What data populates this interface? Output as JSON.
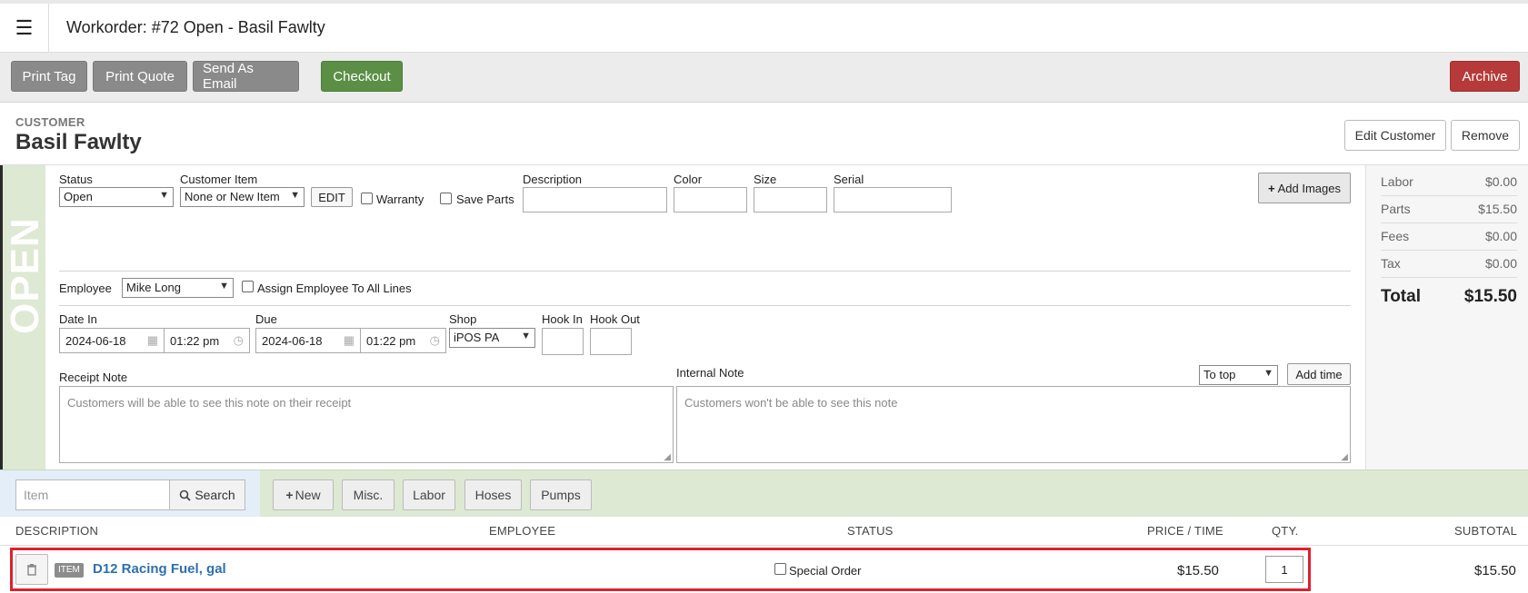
{
  "header": {
    "title": "Workorder:  #72 Open - Basil Fawlty"
  },
  "actions": {
    "print_tag": "Print Tag",
    "print_quote": "Print Quote",
    "send_email": "Send As Email",
    "checkout": "Checkout",
    "archive": "Archive"
  },
  "customer": {
    "label": "CUSTOMER",
    "name": "Basil Fawlty",
    "edit_label": "Edit Customer",
    "remove_label": "Remove"
  },
  "status_strip": "OPEN",
  "form": {
    "status_label": "Status",
    "status_value": "Open",
    "customer_item_label": "Customer Item",
    "customer_item_value": "None or New Item",
    "edit_btn": "EDIT",
    "warranty_label": "Warranty",
    "save_parts_label": "Save Parts",
    "description_label": "Description",
    "color_label": "Color",
    "size_label": "Size",
    "serial_label": "Serial",
    "add_images": "Add Images",
    "employee_label": "Employee",
    "employee_value": "Mike Long",
    "assign_all_label": "Assign Employee To All Lines",
    "date_in_label": "Date In",
    "date_in": "2024-06-18",
    "time_in": "01:22 pm",
    "due_label": "Due",
    "due_date": "2024-06-18",
    "due_time": "01:22 pm",
    "shop_label": "Shop",
    "shop_value": "iPOS PA",
    "hook_in_label": "Hook In",
    "hook_out_label": "Hook Out",
    "receipt_note_label": "Receipt Note",
    "receipt_note_placeholder": "Customers will be able to see this note on their receipt",
    "internal_note_label": "Internal Note",
    "internal_note_placeholder": "Customers won't be able to see this note",
    "to_top_value": "To top",
    "add_time": "Add time"
  },
  "summary": {
    "labor_label": "Labor",
    "labor": "$0.00",
    "parts_label": "Parts",
    "parts": "$15.50",
    "fees_label": "Fees",
    "fees": "$0.00",
    "tax_label": "Tax",
    "tax": "$0.00",
    "total_label": "Total",
    "total": "$15.50"
  },
  "item_bar": {
    "item_placeholder": "Item",
    "search_label": "Search",
    "new_label": "New",
    "misc_label": "Misc.",
    "labor_label": "Labor",
    "hoses_label": "Hoses",
    "pumps_label": "Pumps"
  },
  "table": {
    "headers": {
      "description": "DESCRIPTION",
      "employee": "EMPLOYEE",
      "status": "STATUS",
      "price": "PRICE / TIME",
      "qty": "QTY.",
      "subtotal": "SUBTOTAL"
    },
    "rows": [
      {
        "badge": "ITEM",
        "name": "D12 Racing Fuel, gal",
        "special_order_label": "Special Order",
        "price": "$15.50",
        "qty": "1",
        "subtotal": "$15.50"
      }
    ]
  },
  "colors": {
    "checkout": "#5b8f45",
    "archive": "#b63a3a",
    "open_strip": "#dde9d2",
    "highlight": "#e0202e",
    "link": "#2f6fae"
  }
}
